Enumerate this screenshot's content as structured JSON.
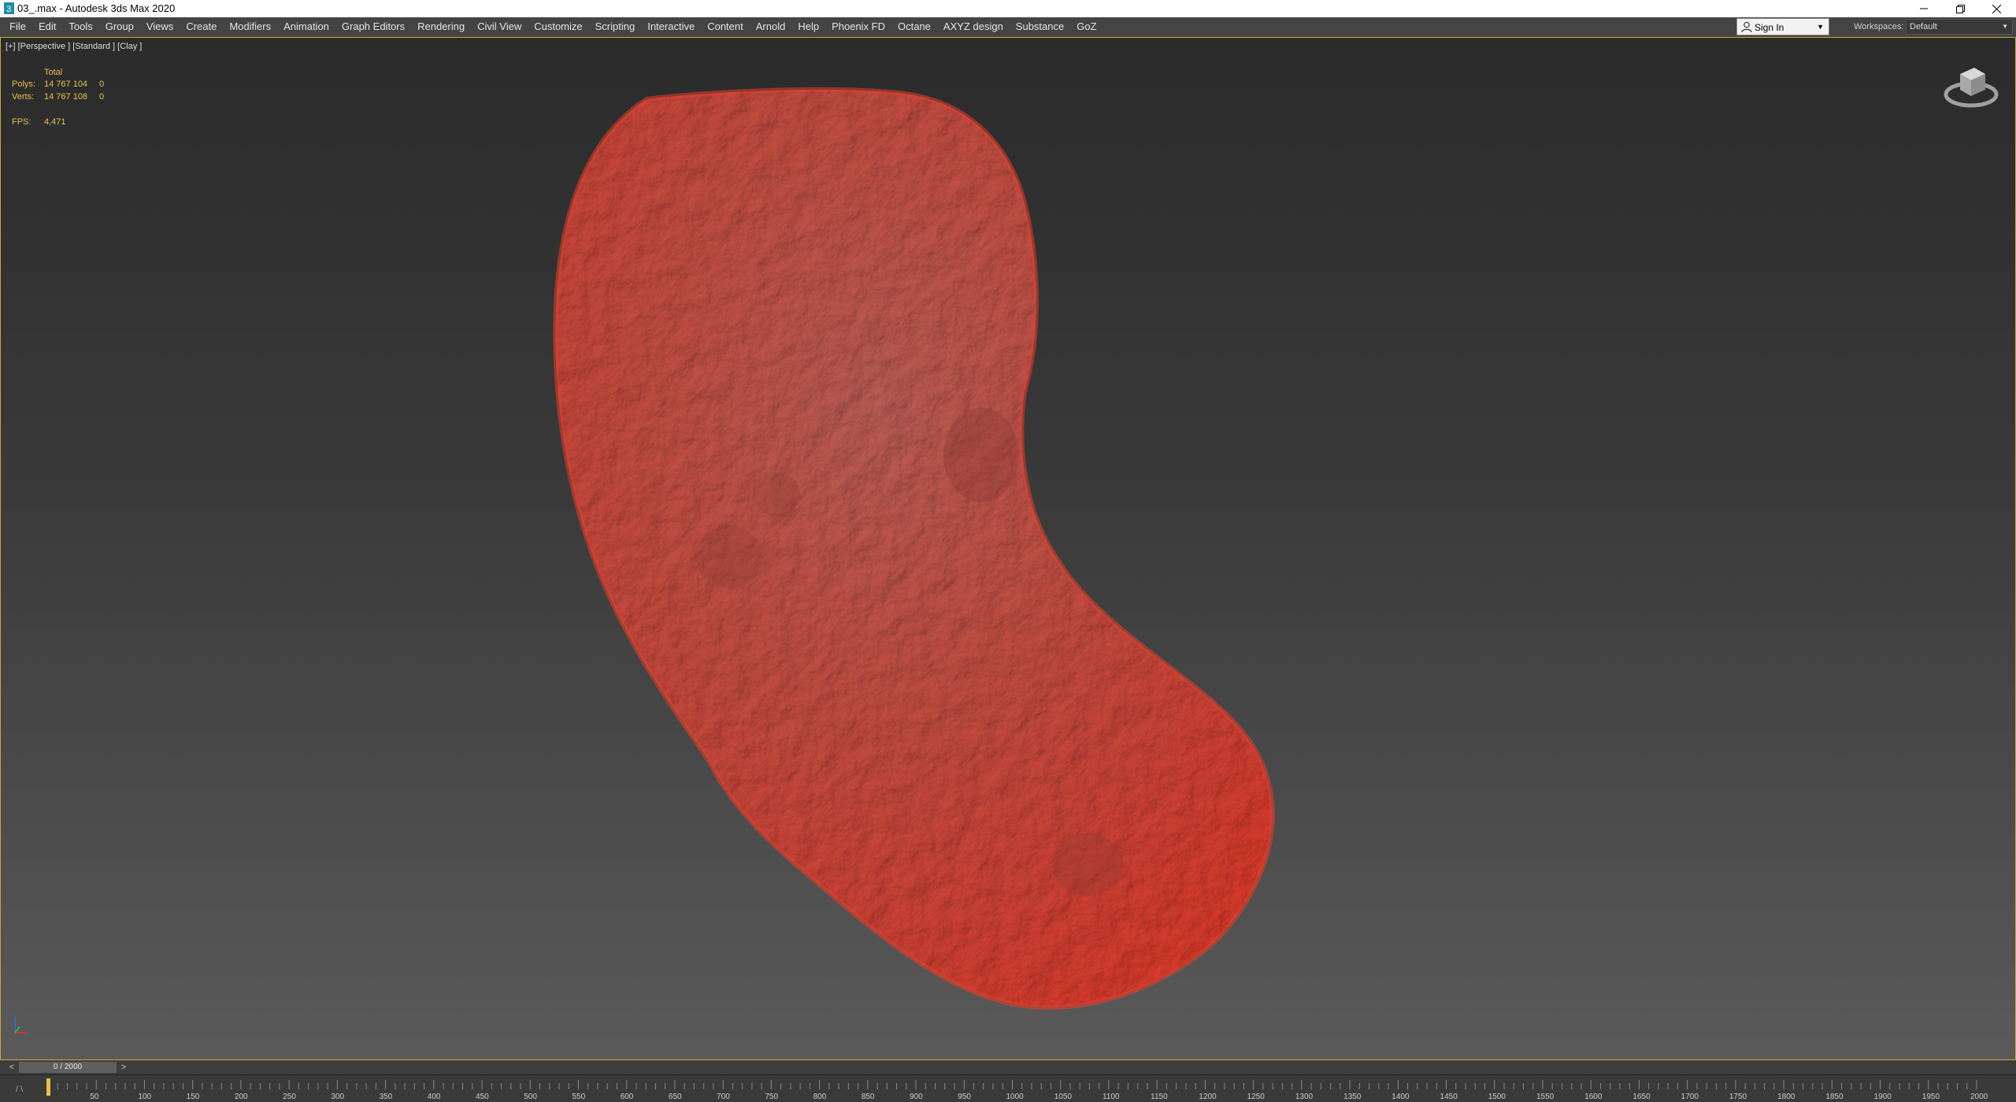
{
  "window": {
    "title": "03_.max - Autodesk 3ds Max 2020",
    "controls": [
      "minimize-icon",
      "restore-icon",
      "close-icon"
    ]
  },
  "menubar": {
    "items": [
      "File",
      "Edit",
      "Tools",
      "Group",
      "Views",
      "Create",
      "Modifiers",
      "Animation",
      "Graph Editors",
      "Rendering",
      "Civil View",
      "Customize",
      "Scripting",
      "Interactive",
      "Content",
      "Arnold",
      "Help",
      "Phoenix FD",
      "Octane",
      "AXYZ design",
      "Substance",
      "GoZ"
    ]
  },
  "account": {
    "sign_in": "Sign In"
  },
  "workspaces": {
    "label": "Workspaces:",
    "value": "Default"
  },
  "viewport": {
    "label": "[+] [Perspective ] [Standard ] [Clay ]",
    "stats": {
      "header": "Total",
      "polys_label": "Polys:",
      "polys_value": "14 767 104",
      "polys_sel": "0",
      "verts_label": "Verts:",
      "verts_value": "14 767 108",
      "verts_sel": "0",
      "fps_label": "FPS:",
      "fps_value": "4,471"
    },
    "object_color": "#c8463a"
  },
  "timeline": {
    "frame_display": "0 / 2000",
    "ticks": [
      "50",
      "100",
      "150",
      "200",
      "250",
      "300",
      "350",
      "400",
      "450",
      "500",
      "550",
      "600",
      "650",
      "700",
      "750",
      "800",
      "850",
      "900",
      "950",
      "1000",
      "1050",
      "1100",
      "1150",
      "1200",
      "1250",
      "1300",
      "1350",
      "1400",
      "1450",
      "1500",
      "1550",
      "1600",
      "1650",
      "1700",
      "1750",
      "1800",
      "1850",
      "1900",
      "1950",
      "2000"
    ]
  },
  "colors": {
    "accent": "#c8a83a",
    "stats_text": "#e8c14a"
  }
}
